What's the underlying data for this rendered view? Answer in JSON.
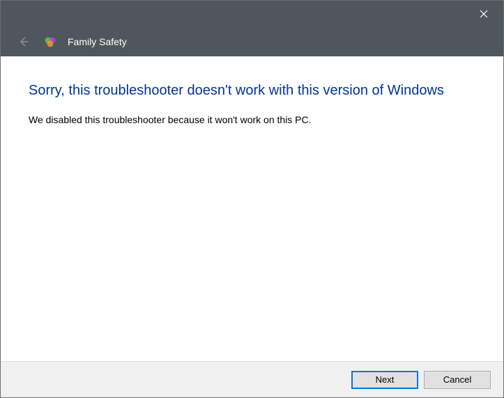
{
  "titlebar": {
    "close_label": "Close"
  },
  "header": {
    "app_title": "Family Safety"
  },
  "content": {
    "heading": "Sorry, this troubleshooter doesn't work with this version of Windows",
    "body": "We disabled this troubleshooter because it won't work on this PC."
  },
  "footer": {
    "next_label": "Next",
    "cancel_label": "Cancel"
  }
}
